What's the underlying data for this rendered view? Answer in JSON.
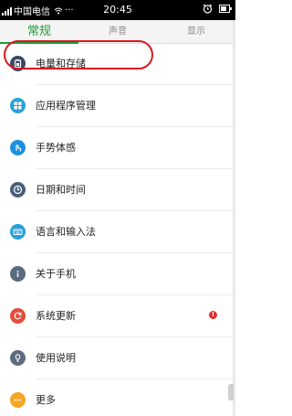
{
  "status_bar": {
    "carrier": "中国电信",
    "time": "20:45",
    "more": "···"
  },
  "tabs": [
    {
      "label": "常规",
      "active": true
    },
    {
      "label": "声音",
      "active": false
    },
    {
      "label": "显示",
      "active": false
    }
  ],
  "items": [
    {
      "label": "电量和存储",
      "icon": "battery-storage-icon",
      "color": "#3a4a66"
    },
    {
      "label": "应用程序管理",
      "icon": "apps-icon",
      "color": "#2aa0d8"
    },
    {
      "label": "手势体感",
      "icon": "gesture-icon",
      "color": "#1d8fe0"
    },
    {
      "label": "日期和时间",
      "icon": "clock-icon",
      "color": "#4a5e78"
    },
    {
      "label": "语言和输入法",
      "icon": "keyboard-icon",
      "color": "#2a9fd8"
    },
    {
      "label": "关于手机",
      "icon": "info-icon",
      "color": "#5a6a7e"
    },
    {
      "label": "系统更新",
      "icon": "refresh-icon",
      "color": "#e64b3c",
      "badge": "!"
    },
    {
      "label": "使用说明",
      "icon": "lightbulb-icon",
      "color": "#5d6c80"
    },
    {
      "label": "更多",
      "icon": "more-icon",
      "color": "#f5a623"
    }
  ],
  "colors": {
    "accent": "#1e9c38",
    "highlight": "#d81920",
    "badge": "#e1312c"
  }
}
